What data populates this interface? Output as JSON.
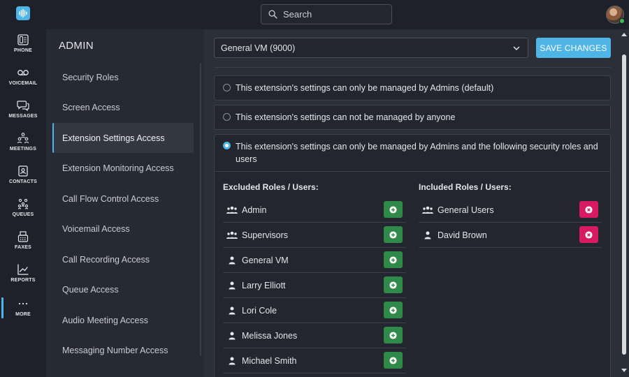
{
  "search": {
    "placeholder": "Search"
  },
  "rail": {
    "items": [
      {
        "label": "PHONE",
        "icon": "phone-icon"
      },
      {
        "label": "VOICEMAIL",
        "icon": "voicemail-icon"
      },
      {
        "label": "MESSAGES",
        "icon": "messages-icon"
      },
      {
        "label": "MEETINGS",
        "icon": "meetings-icon"
      },
      {
        "label": "CONTACTS",
        "icon": "contacts-icon"
      },
      {
        "label": "QUEUES",
        "icon": "queues-icon"
      },
      {
        "label": "FAXES",
        "icon": "fax-icon"
      },
      {
        "label": "REPORTS",
        "icon": "reports-icon"
      },
      {
        "label": "MORE",
        "icon": "more-icon"
      }
    ]
  },
  "admin": {
    "title": "ADMIN",
    "items": [
      {
        "label": "Security Roles"
      },
      {
        "label": "Screen Access"
      },
      {
        "label": "Extension Settings Access",
        "active": true
      },
      {
        "label": "Extension Monitoring Access"
      },
      {
        "label": "Call Flow Control Access"
      },
      {
        "label": "Voicemail Access"
      },
      {
        "label": "Call Recording Access"
      },
      {
        "label": "Queue Access"
      },
      {
        "label": "Audio Meeting Access"
      },
      {
        "label": "Messaging Number Access"
      }
    ]
  },
  "main": {
    "selected_extension": "General VM (9000)",
    "save_label": "SAVE CHANGES",
    "options": [
      {
        "label": "This extension's settings can only be managed by Admins (default)",
        "checked": false
      },
      {
        "label": "This extension's settings can not be managed by anyone",
        "checked": false
      },
      {
        "label": "This extension's settings can only be managed by Admins and the following security roles and users",
        "checked": true
      }
    ],
    "excluded": {
      "heading": "Excluded Roles / Users:",
      "rows": [
        {
          "label": "Admin",
          "type": "group"
        },
        {
          "label": "Supervisors",
          "type": "group"
        },
        {
          "label": "General VM",
          "type": "user"
        },
        {
          "label": "Larry Elliott",
          "type": "user"
        },
        {
          "label": "Lori Cole",
          "type": "user"
        },
        {
          "label": "Melissa Jones",
          "type": "user"
        },
        {
          "label": "Michael Smith",
          "type": "user"
        }
      ]
    },
    "included": {
      "heading": "Included Roles / Users:",
      "rows": [
        {
          "label": "General Users",
          "type": "group"
        },
        {
          "label": "David Brown",
          "type": "user"
        }
      ]
    }
  },
  "colors": {
    "accent": "#4fb4e6",
    "add": "#2f8a4a",
    "remove": "#d81b60"
  }
}
